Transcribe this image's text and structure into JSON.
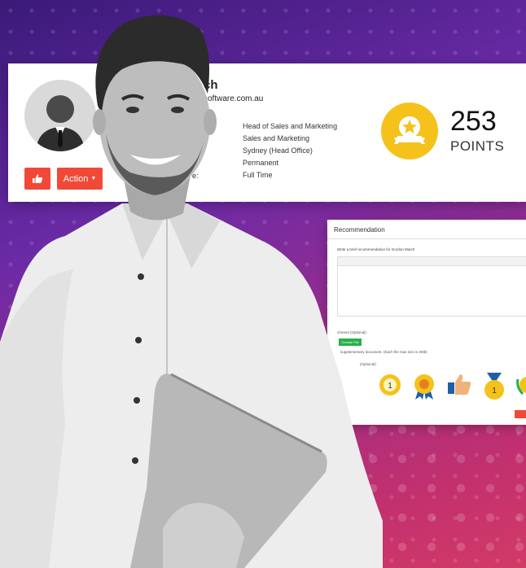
{
  "profile": {
    "name_visible": "ch",
    "email_visible": "software.com.au",
    "action_label": "Action",
    "fields": [
      {
        "label": "",
        "value": "Head of Sales and Marketing"
      },
      {
        "label": "",
        "value": "Sales and Marketing"
      },
      {
        "label": "",
        "value": "Sydney (Head Office)"
      },
      {
        "label": "s:",
        "value": "Permanent"
      },
      {
        "label": "e:",
        "value": "Full Time"
      }
    ],
    "points_value": "253",
    "points_label": "POINTS"
  },
  "recommendation": {
    "title": "Recommendation",
    "prompt": "Write a brief recommendation for Gordon Mutch",
    "attachment_label": "chment (Optional)",
    "file_button": "Choose File",
    "file_hint": "supplementary document. (Each file max size is 2Mb)",
    "badge_label": "(Optional)"
  },
  "colors": {
    "accent": "#f24838",
    "badge": "#f5c21b"
  }
}
